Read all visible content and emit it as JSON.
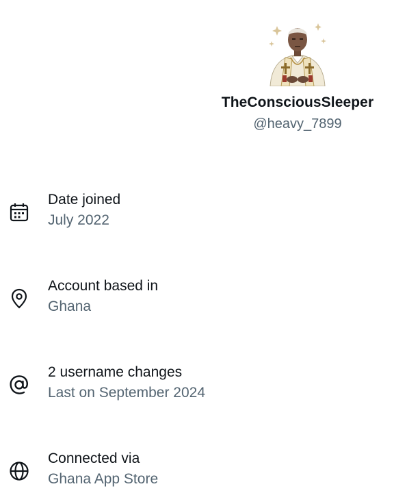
{
  "profile": {
    "display_name": "TheConsciousSleeper",
    "handle": "@heavy_7899",
    "avatar_icon": "avatar-illustration"
  },
  "info": [
    {
      "icon": "calendar-icon",
      "label": "Date joined",
      "value": "July 2022"
    },
    {
      "icon": "location-pin-icon",
      "label": "Account based in",
      "value": "Ghana"
    },
    {
      "icon": "at-sign-icon",
      "label": "2 username changes",
      "value": "Last on September 2024"
    },
    {
      "icon": "globe-icon",
      "label": "Connected via",
      "value": "Ghana App Store"
    }
  ],
  "colors": {
    "primary_text": "#0f1419",
    "secondary_text": "#536471",
    "background": "#ffffff"
  }
}
